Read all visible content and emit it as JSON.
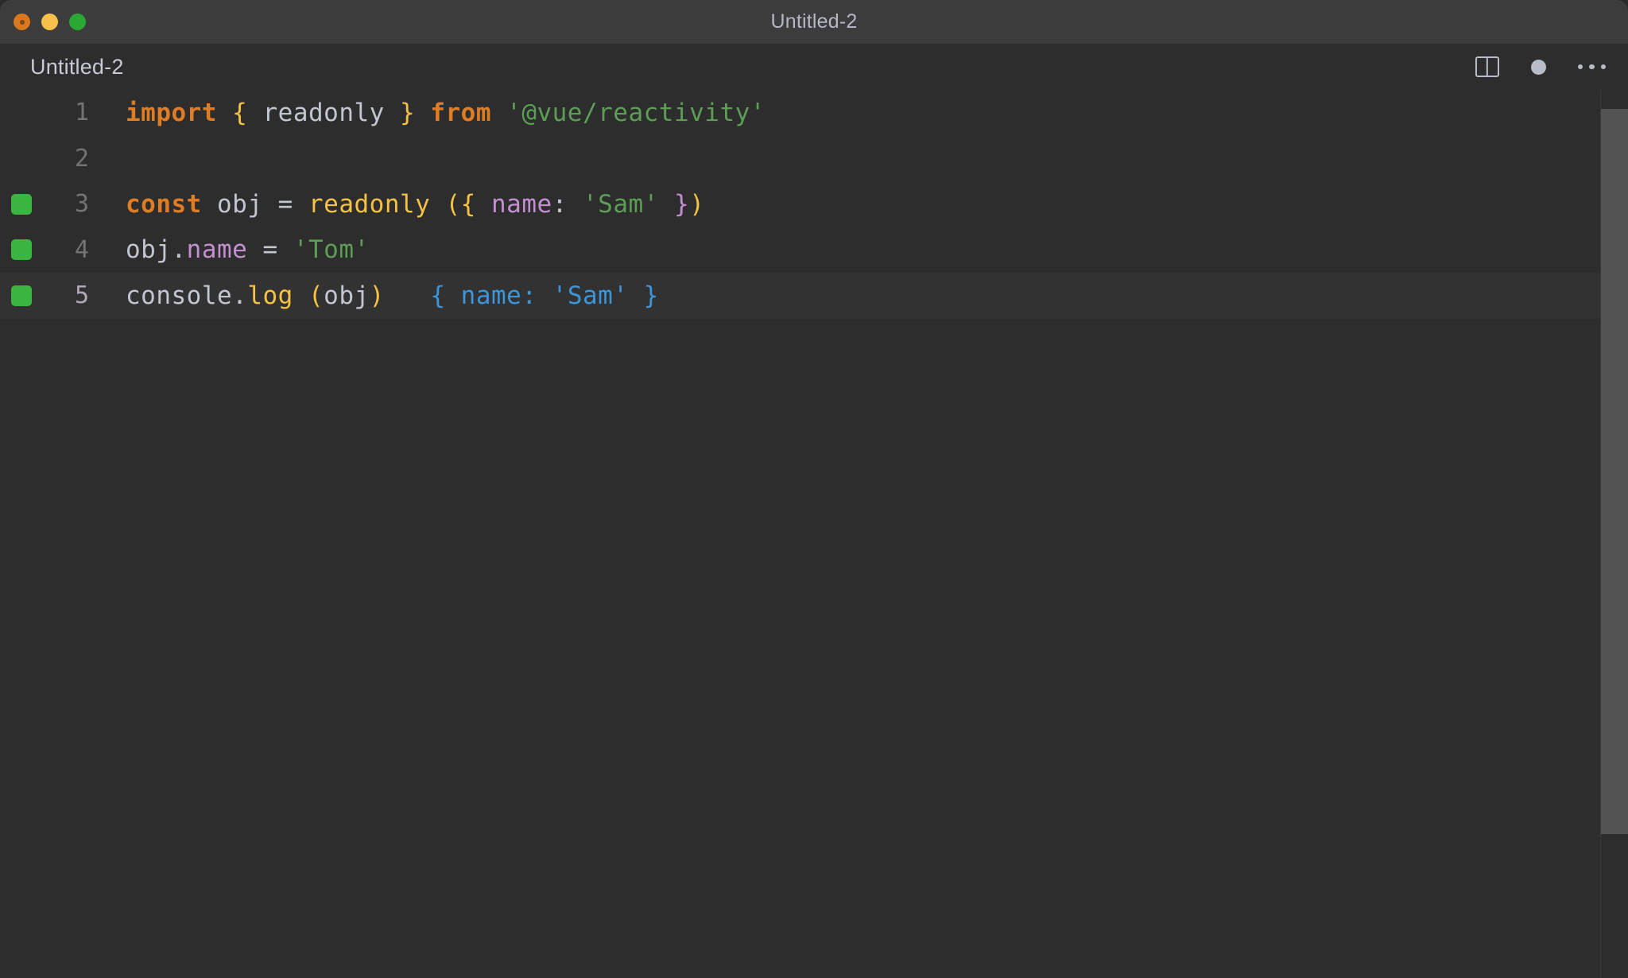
{
  "window": {
    "title": "Untitled-2",
    "traffic_lights": [
      {
        "name": "close",
        "color": "#d9781f"
      },
      {
        "name": "minimize",
        "color": "#f7c04a"
      },
      {
        "name": "maximize",
        "color": "#2aa834"
      }
    ]
  },
  "tabbar": {
    "tab_label": "Untitled-2",
    "actions": [
      {
        "icon": "split-editor-icon"
      },
      {
        "icon": "unsaved-dot-icon"
      },
      {
        "icon": "more-actions-icon"
      }
    ]
  },
  "editor": {
    "language": "javascript",
    "active_line": 5,
    "colors": {
      "background": "#2d2d2d",
      "active_line": "#323232",
      "keyword": "#e07c24",
      "brace": "#f5c244",
      "identifier": "#c3c6d1",
      "string": "#5b9e54",
      "property": "#c48fd0",
      "inline_value": "#3b95d8",
      "gutter_marker": "#3cb441",
      "line_number": "#737373",
      "line_number_active": "#b0a8b8",
      "scrollbar": "#535353"
    },
    "lines": [
      {
        "number": "1",
        "marker": false,
        "active": false,
        "tokens": [
          {
            "t": "import",
            "c": "tok-kw"
          },
          {
            "t": " ",
            "c": "tok-plain"
          },
          {
            "t": "{",
            "c": "tok-brace"
          },
          {
            "t": " ",
            "c": "tok-plain"
          },
          {
            "t": "readonly",
            "c": "tok-ident"
          },
          {
            "t": " ",
            "c": "tok-plain"
          },
          {
            "t": "}",
            "c": "tok-brace"
          },
          {
            "t": " ",
            "c": "tok-plain"
          },
          {
            "t": "from",
            "c": "tok-kw"
          },
          {
            "t": " ",
            "c": "tok-plain"
          },
          {
            "t": "'@vue/reactivity'",
            "c": "tok-string"
          }
        ],
        "plain": "import { readonly } from '@vue/reactivity'"
      },
      {
        "number": "2",
        "marker": false,
        "active": false,
        "tokens": [],
        "plain": ""
      },
      {
        "number": "3",
        "marker": true,
        "active": false,
        "tokens": [
          {
            "t": "const",
            "c": "tok-kw"
          },
          {
            "t": " ",
            "c": "tok-plain"
          },
          {
            "t": "obj",
            "c": "tok-ident"
          },
          {
            "t": " ",
            "c": "tok-plain"
          },
          {
            "t": "=",
            "c": "tok-op"
          },
          {
            "t": " ",
            "c": "tok-plain"
          },
          {
            "t": "readonly",
            "c": "tok-fn"
          },
          {
            "t": " ",
            "c": "tok-plain"
          },
          {
            "t": "(",
            "c": "tok-paren"
          },
          {
            "t": "{",
            "c": "tok-brace"
          },
          {
            "t": " ",
            "c": "tok-plain"
          },
          {
            "t": "name",
            "c": "tok-prop"
          },
          {
            "t": ":",
            "c": "tok-plain"
          },
          {
            "t": " ",
            "c": "tok-plain"
          },
          {
            "t": "'Sam'",
            "c": "tok-string"
          },
          {
            "t": " ",
            "c": "tok-plain"
          },
          {
            "t": "}",
            "c": "tok-prop"
          },
          {
            "t": ")",
            "c": "tok-paren"
          }
        ],
        "plain": "const obj = readonly ({ name: 'Sam' })"
      },
      {
        "number": "4",
        "marker": true,
        "active": false,
        "tokens": [
          {
            "t": "obj",
            "c": "tok-ident"
          },
          {
            "t": ".",
            "c": "tok-plain"
          },
          {
            "t": "name",
            "c": "tok-prop"
          },
          {
            "t": " ",
            "c": "tok-plain"
          },
          {
            "t": "=",
            "c": "tok-op"
          },
          {
            "t": " ",
            "c": "tok-plain"
          },
          {
            "t": "'Tom'",
            "c": "tok-string"
          }
        ],
        "plain": "obj.name = 'Tom'"
      },
      {
        "number": "5",
        "marker": true,
        "active": true,
        "tokens": [
          {
            "t": "console",
            "c": "tok-ident"
          },
          {
            "t": ".",
            "c": "tok-plain"
          },
          {
            "t": "log",
            "c": "tok-fn"
          },
          {
            "t": " ",
            "c": "tok-plain"
          },
          {
            "t": "(",
            "c": "tok-paren"
          },
          {
            "t": "obj",
            "c": "tok-ident"
          },
          {
            "t": ")",
            "c": "tok-paren"
          },
          {
            "t": "   ",
            "c": "tok-plain"
          },
          {
            "t": "{ name: 'Sam' }",
            "c": "tok-inline"
          }
        ],
        "plain": "console.log (obj)   { name: 'Sam' }"
      }
    ]
  }
}
